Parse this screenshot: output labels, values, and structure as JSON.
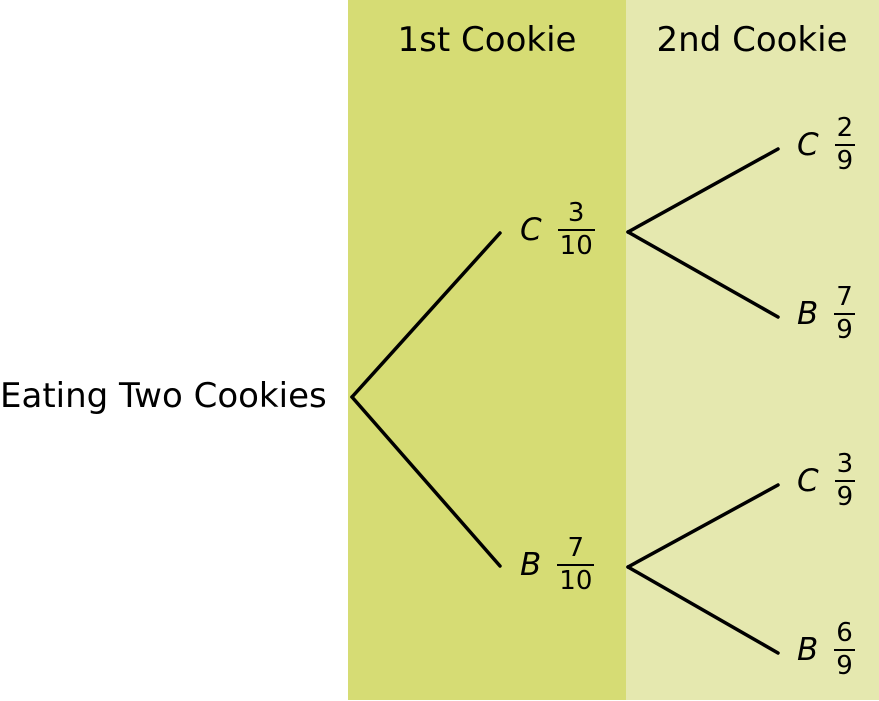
{
  "headers": {
    "first": "1st Cookie",
    "second": "2nd Cookie"
  },
  "root": "Eating Two Cookies",
  "first_level": [
    {
      "letter": "C",
      "num": "3",
      "den": "10"
    },
    {
      "letter": "B",
      "num": "7",
      "den": "10"
    }
  ],
  "second_level": [
    {
      "letter": "C",
      "num": "2",
      "den": "9"
    },
    {
      "letter": "B",
      "num": "7",
      "den": "9"
    },
    {
      "letter": "C",
      "num": "3",
      "den": "9"
    },
    {
      "letter": "B",
      "num": "6",
      "den": "9"
    }
  ],
  "colors": {
    "first_band": "#d6dc74",
    "second_band": "#e5e8af",
    "lines": "#000000"
  }
}
